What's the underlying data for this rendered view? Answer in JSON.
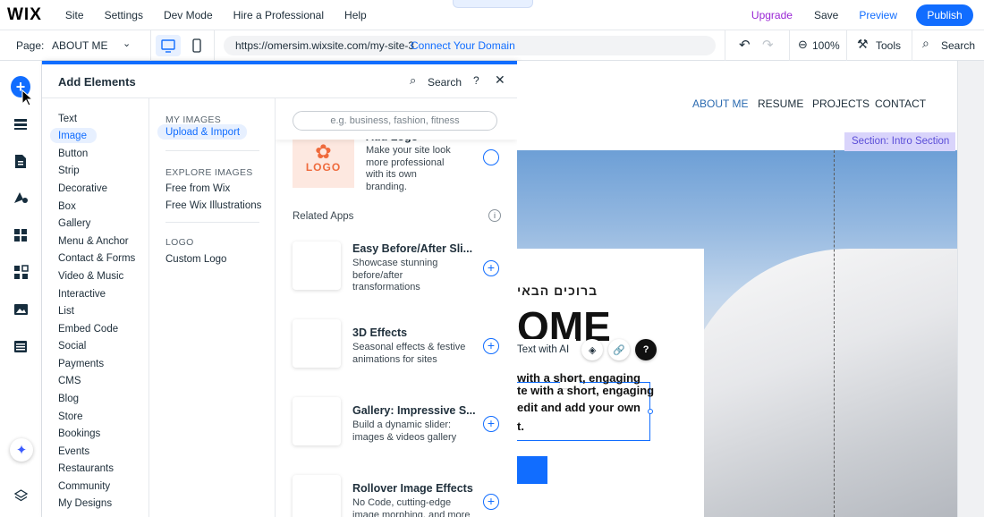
{
  "topbar": {
    "logo": "WIX",
    "menu": [
      "Site",
      "Settings",
      "Dev Mode",
      "Hire a Professional",
      "Help"
    ],
    "upgrade": "Upgrade",
    "save": "Save",
    "preview": "Preview",
    "publish": "Publish"
  },
  "urlbar": {
    "page_label": "Page:",
    "page_value": "ABOUT ME",
    "url": "https://omersim.wixsite.com/my-site-3",
    "connect": "Connect Your Domain",
    "zoom": "100%",
    "tools": "Tools",
    "search": "Search"
  },
  "panel": {
    "title": "Add Elements",
    "search": "Search",
    "help": "?",
    "categories": [
      "Text",
      "Image",
      "Button",
      "Strip",
      "Decorative",
      "Box",
      "Gallery",
      "Menu & Anchor",
      "Contact & Forms",
      "Video & Music",
      "Interactive",
      "List",
      "Embed Code",
      "Social",
      "Payments",
      "CMS",
      "Blog",
      "Store",
      "Bookings",
      "Events",
      "Restaurants",
      "Community",
      "My Designs"
    ],
    "selected_category_index": 1,
    "subsections": {
      "my_images_head": "MY IMAGES",
      "upload": "Upload & Import",
      "explore_head": "EXPLORE IMAGES",
      "free_wix": "Free from Wix",
      "free_illus": "Free Wix Illustrations",
      "logo_head": "LOGO",
      "custom_logo": "Custom Logo"
    },
    "content": {
      "search_placeholder": "e.g. business, fashion, fitness",
      "logo_word": "LOGO",
      "add_logo_title": "Add Logo",
      "add_logo_desc": "Make your site look more professional with its own branding.",
      "related_apps": "Related Apps",
      "apps": [
        {
          "title": "Easy Before/After Sli...",
          "desc": "Showcase stunning before/after transformations"
        },
        {
          "title": "3D Effects",
          "desc": "Seasonal effects & festive animations for sites"
        },
        {
          "title": "Gallery: Impressive S...",
          "desc": "Build a dynamic slider: images & videos gallery"
        },
        {
          "title": "Rollover Image Effects",
          "desc": "No Code, cutting-edge image morphing, and more"
        }
      ]
    }
  },
  "canvas": {
    "nav": [
      "ABOUT ME",
      "RESUME",
      "PROJECTS",
      "CONTACT"
    ],
    "section_label": "Section: Intro Section",
    "hebrew": "ברוכים הבאי",
    "heading_fragment": "OME",
    "ai_text": "Text with AI",
    "paragraph": [
      "with a short, engaging",
      "te with a short, engaging",
      "edit and add your own",
      "o to edit and add your own",
      "t."
    ]
  }
}
